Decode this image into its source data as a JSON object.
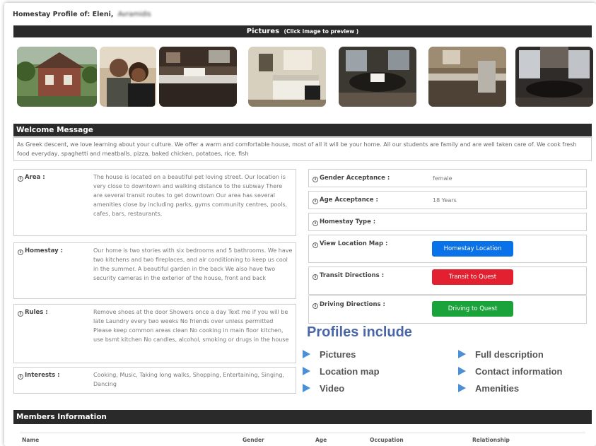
{
  "profile": {
    "label": "Homestay Profile of:",
    "first_name": "Eleni,",
    "last_name": "Avramidis"
  },
  "pictures": {
    "title": "Pictures",
    "hint": "(Click image to preview )"
  },
  "welcome": {
    "title": "Welcome Message",
    "text": "As Greek descent, we love learning about your culture. We offer a warm and comfortable house, most of all it will be your home. All our students are family and are well taken care of. We cook fresh food everyday, spaghetti and meatballs, pizza, baked chicken, potatoes, rice, fish"
  },
  "details_left": [
    {
      "label": "Area :",
      "value": "The house is located on a beautiful pet loving street. Our location is very close to downtown and walking distance to the subway There are several transit routes to get downtown Our area has several amenities close by including parks, gyms community centres, pools, cafes, bars, restaurants,"
    },
    {
      "label": "Homestay :",
      "value": "Our home is two stories with six bedrooms and 5 bathrooms. We have two kitchens and two fireplaces, and air conditioning to keep us cool in the summer. A beautiful garden in the back We also have two security cameras in the exterior of the house, front and back"
    },
    {
      "label": "Rules :",
      "value": "Remove shoes at the door Showers once a day Text me if you will be late Laundry every two weeks No friends over unless permitted Please keep common areas clean No cooking in main floor kitchen, use bsmt kitchen No candles, alcohol, smoking or drugs in the house"
    },
    {
      "label": "Interests :",
      "value": "Cooking, Music, Taking long walks, Shopping, Entertaining, Singing, Dancing"
    }
  ],
  "details_right": {
    "gender": {
      "label": "Gender Acceptance :",
      "value": "female"
    },
    "age": {
      "label": "Age Acceptance :",
      "value": "18 Years"
    },
    "type": {
      "label": "Homestay Type :",
      "value": ""
    },
    "map": {
      "label": "View Location Map :",
      "button": "Homestay Location"
    },
    "transit": {
      "label": "Transit Directions :",
      "button": "Transit to Quest"
    },
    "driving": {
      "label": "Driving Directions :",
      "button": "Driving to Quest"
    }
  },
  "overlay": {
    "title": "Profiles include",
    "col1": [
      "Pictures",
      "Location map",
      "Video"
    ],
    "col2": [
      "Full description",
      "Contact information",
      "Amenities"
    ]
  },
  "members": {
    "title": "Members Information",
    "columns": [
      "Name",
      "Gender",
      "Age",
      "Occupation",
      "Relationship"
    ]
  },
  "colors": {
    "header_bar": "#2a2a2a",
    "blue_button": "#0a72e8",
    "red_button": "#e2202f",
    "green_button": "#19a33a",
    "accent_title": "#4a66a8",
    "arrow": "#4a8fd8"
  }
}
